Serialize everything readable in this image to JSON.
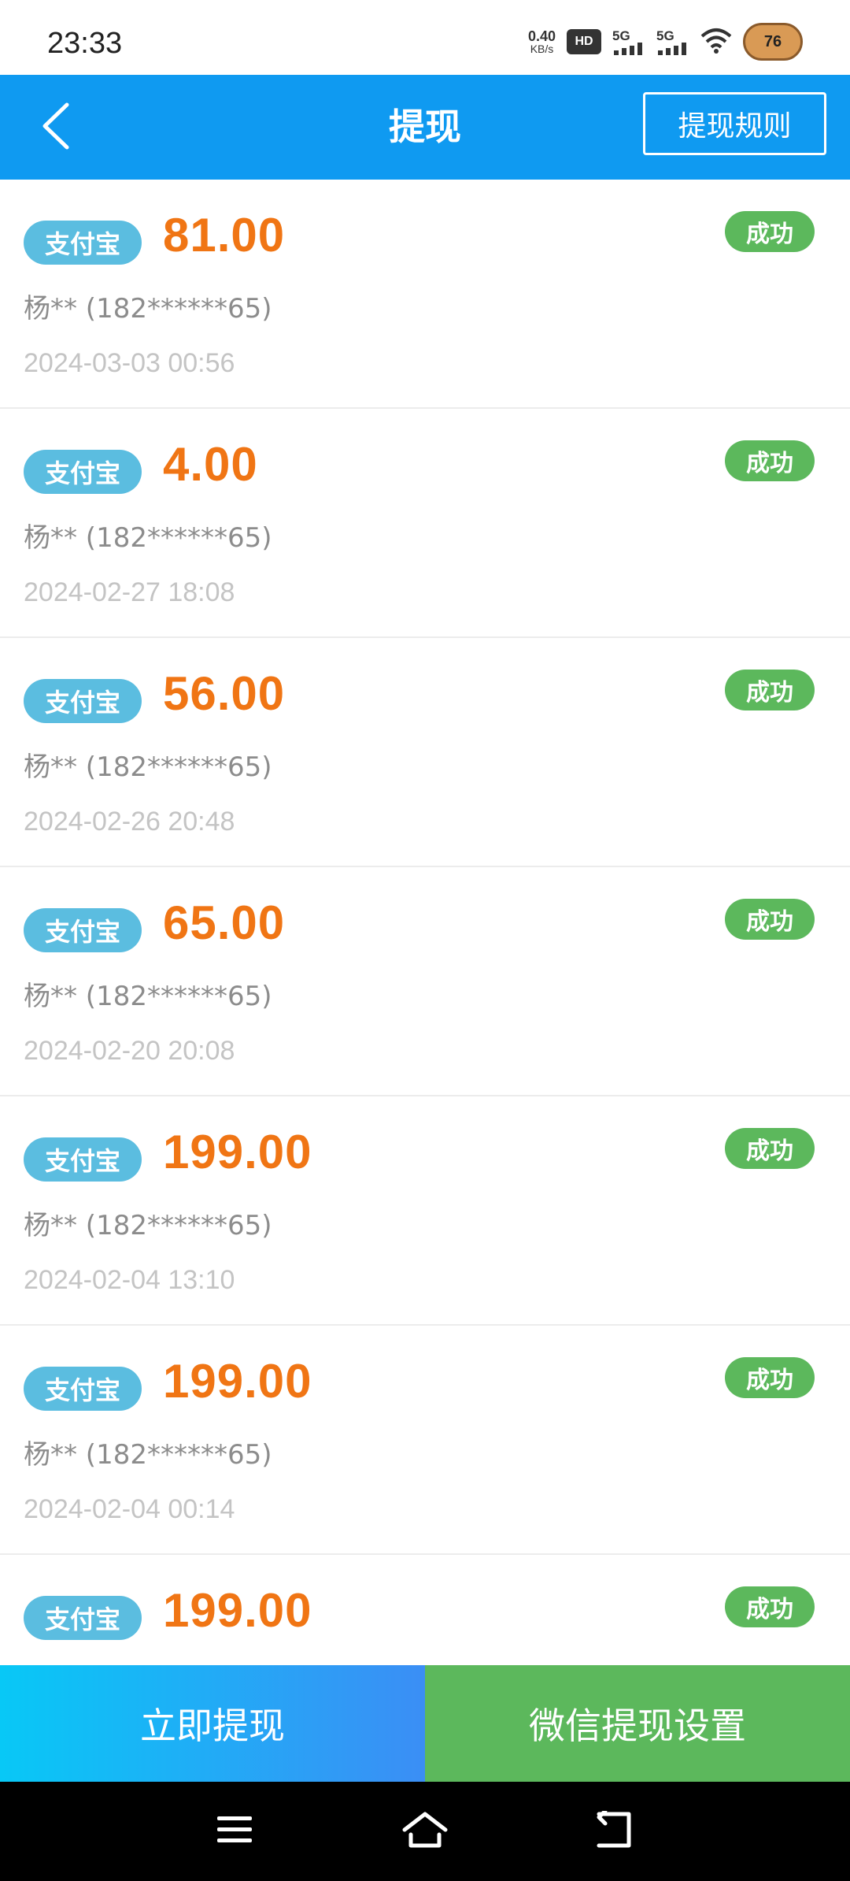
{
  "status_bar": {
    "time": "23:33",
    "net_speed_value": "0.40",
    "net_speed_unit": "KB/s",
    "hd_label": "HD",
    "signal1_label": "5G",
    "signal2_label": "5G",
    "battery": "76"
  },
  "header": {
    "title": "提现",
    "rules_label": "提现规则",
    "back_icon": "chevron-left-icon"
  },
  "records": [
    {
      "method": "支付宝",
      "amount": "81.00",
      "status": "成功",
      "account": "杨** (182******65)",
      "date": "2024-03-03 00:56"
    },
    {
      "method": "支付宝",
      "amount": "4.00",
      "status": "成功",
      "account": "杨** (182******65)",
      "date": "2024-02-27 18:08"
    },
    {
      "method": "支付宝",
      "amount": "56.00",
      "status": "成功",
      "account": "杨** (182******65)",
      "date": "2024-02-26 20:48"
    },
    {
      "method": "支付宝",
      "amount": "65.00",
      "status": "成功",
      "account": "杨** (182******65)",
      "date": "2024-02-20 20:08"
    },
    {
      "method": "支付宝",
      "amount": "199.00",
      "status": "成功",
      "account": "杨** (182******65)",
      "date": "2024-02-04 13:10"
    },
    {
      "method": "支付宝",
      "amount": "199.00",
      "status": "成功",
      "account": "杨** (182******65)",
      "date": "2024-02-04 00:14"
    },
    {
      "method": "支付宝",
      "amount": "199.00",
      "status": "成功",
      "account": "",
      "date": ""
    }
  ],
  "actions": {
    "withdraw_label": "立即提现",
    "wechat_settings_label": "微信提现设置"
  },
  "colors": {
    "header_bg": "#0f9af1",
    "amount": "#f07514",
    "tag_bg": "#5bbde0",
    "status_success": "#5cb85c"
  },
  "nav_icons": [
    "menu-icon",
    "home-icon",
    "back-icon"
  ]
}
